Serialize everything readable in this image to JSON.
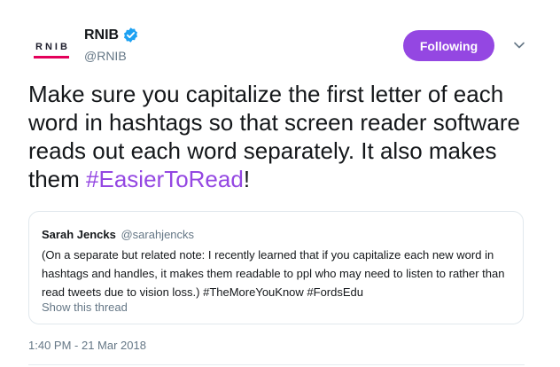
{
  "author": {
    "logo_text": "RNIB",
    "name": "RNIB",
    "handle": "@RNIB",
    "verified": true
  },
  "follow_button": {
    "label": "Following"
  },
  "tweet": {
    "text_before": "Make sure you capitalize the first letter of each word in hashtags so that screen reader software reads out each word separately.  It also makes them ",
    "hashtag": "#EasierToRead",
    "text_after": "!"
  },
  "quoted_tweet": {
    "name": "Sarah Jencks",
    "handle": "@sarahjencks",
    "text": "(On a separate but related note: I recently learned that if you capitalize each new word in hashtags and handles, it makes them readable to ppl who may need to listen to rather than read tweets due to vision loss.) #TheMoreYouKnow #FordsEdu",
    "show_thread_label": "Show this thread"
  },
  "timestamp": "1:40 PM - 21 Mar 2018",
  "colors": {
    "accent": "#9447e2",
    "logo_bar": "#e4005a",
    "verified": "#1da1f2",
    "muted": "#657786"
  },
  "icons": {
    "verified": "verified-badge-icon",
    "caret": "chevron-down-icon"
  }
}
